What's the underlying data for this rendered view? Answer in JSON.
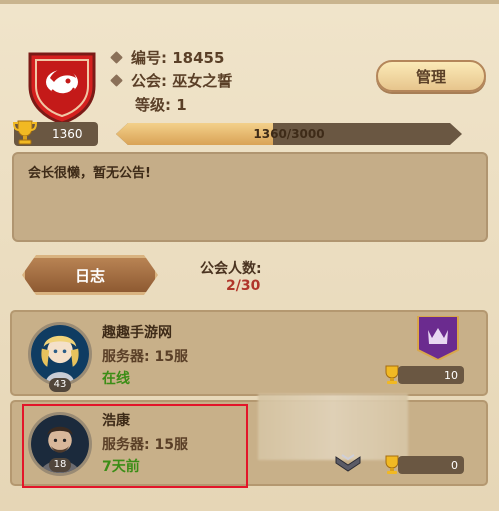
{
  "guild": {
    "id_label": "编号: 18455",
    "name_label": "公会: 巫女之誓",
    "level_label": "等级: 1",
    "trophy": "1360",
    "xp_text": "1360/3000",
    "xp_fraction": 0.4533,
    "notice": "会长很懒，暂无公告!"
  },
  "buttons": {
    "manage": "管理",
    "log": "日志"
  },
  "members": {
    "label": "公会人数:",
    "count": "2/30",
    "list": [
      {
        "name": "趣趣手游网",
        "server": "服务器: 15服",
        "status": "在线",
        "level": "43",
        "score": "10"
      },
      {
        "name": "浩康",
        "server": "服务器: 15服",
        "status": "7天前",
        "level": "18",
        "score": "0"
      }
    ]
  },
  "icons": {
    "crest": "guild-crest-icon",
    "trophy": "trophy-icon",
    "banner": "crown-banner-icon",
    "rank": "rank-chevron-icon"
  },
  "colors": {
    "online": "#3b8d16",
    "members_count": "#b0352a",
    "highlight": "#e3152a",
    "crest_red": "#d5201f"
  }
}
